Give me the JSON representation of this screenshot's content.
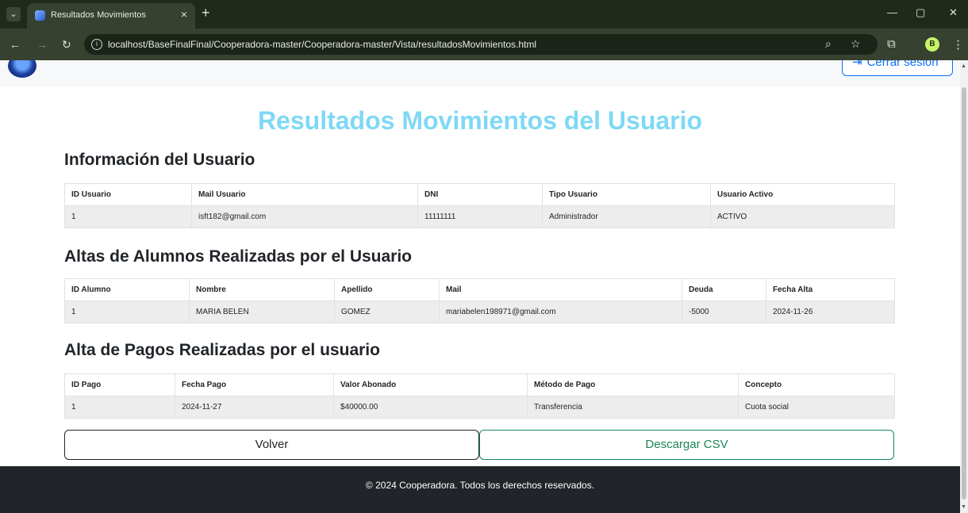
{
  "browser": {
    "tab_title": "Resultados Movimientos",
    "url": "localhost/BaseFinalFinal/Cooperadora-master/Cooperadora-master/Vista/resultadosMovimientos.html",
    "profile_initial": "B"
  },
  "header": {
    "logout_label": "Cerrar sesión"
  },
  "page": {
    "title": "Resultados Movimientos del Usuario"
  },
  "user_info": {
    "title": "Información del Usuario",
    "columns": [
      "ID Usuario",
      "Mail Usuario",
      "DNI",
      "Tipo Usuario",
      "Usuario Activo"
    ],
    "rows": [
      [
        "1",
        "isft182@gmail.com",
        "11111111",
        "Administrador",
        "ACTIVO"
      ]
    ]
  },
  "students": {
    "title": "Altas de Alumnos Realizadas por el Usuario",
    "columns": [
      "ID Alumno",
      "Nombre",
      "Apellido",
      "Mail",
      "Deuda",
      "Fecha Alta"
    ],
    "rows": [
      [
        "1",
        "MARIA BELEN",
        "GOMEZ",
        "mariabelen198971@gmail.com",
        "-5000",
        "2024-11-26"
      ]
    ]
  },
  "payments": {
    "title": "Alta de Pagos Realizadas por el usuario",
    "columns": [
      "ID Pago",
      "Fecha Pago",
      "Valor Abonado",
      "Método de Pago",
      "Concepto"
    ],
    "rows": [
      [
        "1",
        "2024-11-27",
        "$40000.00",
        "Transferencia",
        "Cuota social"
      ]
    ]
  },
  "actions": {
    "back_label": "Volver",
    "csv_label": "Descargar CSV"
  },
  "footer": {
    "text": "© 2024 Cooperadora. Todos los derechos reservados."
  },
  "colors": {
    "title": "#7fd8f5",
    "primary": "#0d6efd",
    "success": "#198754",
    "footer_bg": "#212529"
  }
}
